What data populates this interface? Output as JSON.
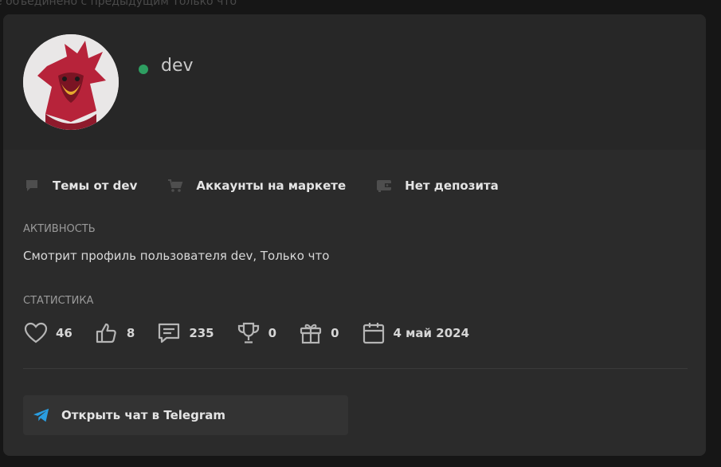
{
  "background": {
    "partial_text": "е объединено с предыдущим Только что"
  },
  "profile": {
    "username": "dev",
    "online": true,
    "online_color": "#2e9e61"
  },
  "links": [
    {
      "label": "Темы от dev",
      "icon": "chat-bubble-icon"
    },
    {
      "label": "Аккаунты на маркете",
      "icon": "cart-icon"
    },
    {
      "label": "Нет депозита",
      "icon": "wallet-icon"
    }
  ],
  "activity": {
    "title": "АКТИВНОСТЬ",
    "text": "Смотрит профиль пользователя dev, Только что"
  },
  "statistics": {
    "title": "СТАТИСТИКА",
    "items": [
      {
        "icon": "heart-icon",
        "value": "46"
      },
      {
        "icon": "thumbs-up-icon",
        "value": "8"
      },
      {
        "icon": "message-icon",
        "value": "235"
      },
      {
        "icon": "trophy-icon",
        "value": "0"
      },
      {
        "icon": "gift-icon",
        "value": "0"
      },
      {
        "icon": "calendar-icon",
        "value": "4 май 2024"
      }
    ]
  },
  "telegram_button": {
    "label": "Открыть чат в Telegram",
    "icon": "telegram-icon",
    "icon_color": "#2a9de0"
  }
}
